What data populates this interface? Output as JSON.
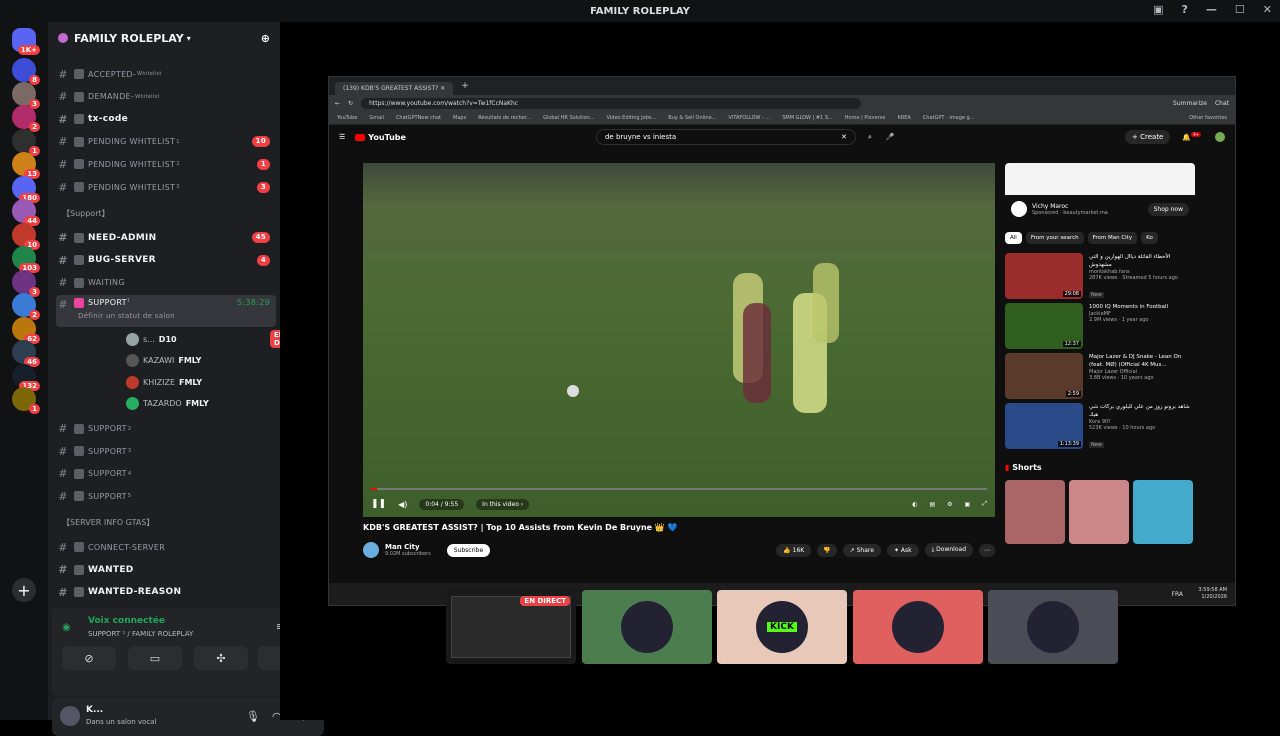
{
  "window": {
    "title": "FAMILY ROLEPLAY"
  },
  "rail": {
    "home_badge": "1K+",
    "servers": [
      {
        "name": "srv-1",
        "color": "#3e4dd8",
        "badge": "8"
      },
      {
        "name": "srv-2",
        "color": "#7a6a63",
        "badge": "3"
      },
      {
        "name": "srv-3",
        "color": "#b22b6b",
        "badge": "2"
      },
      {
        "name": "srv-4",
        "color": "#2f2f2f",
        "badge": "1"
      },
      {
        "name": "srv-5",
        "color": "#d08018",
        "badge": "13"
      },
      {
        "name": "srv-6",
        "color": "#5865f2",
        "badge": "180"
      },
      {
        "name": "srv-7",
        "color": "#9b59b6",
        "badge": "44"
      },
      {
        "name": "srv-8",
        "color": "#c0392b",
        "badge": "10"
      },
      {
        "name": "srv-9",
        "color": "#1e8449",
        "badge": "103"
      },
      {
        "name": "srv-10",
        "color": "#6c3483",
        "badge": "3"
      },
      {
        "name": "srv-11",
        "color": "#3a7bd5",
        "badge": "2"
      },
      {
        "name": "srv-12",
        "color": "#b9770e",
        "badge": "62"
      },
      {
        "name": "srv-13",
        "color": "#2c3e50",
        "badge": "46"
      },
      {
        "name": "srv-14",
        "color": "#17202a",
        "badge": "132"
      },
      {
        "name": "srv-15",
        "color": "#7d6608",
        "badge": "1"
      }
    ]
  },
  "server": {
    "name": "FAMILY ROLEPLAY"
  },
  "channels": [
    {
      "label": "ACCEPTED-",
      "suffix": "Whitelist",
      "bold": false,
      "count": ""
    },
    {
      "label": "DEMANDE-",
      "suffix": "Whitelist",
      "bold": false,
      "count": ""
    },
    {
      "label": "tx-code",
      "suffix": "",
      "bold": true,
      "count": ""
    },
    {
      "label": "PENDING WHITELIST",
      "suffix": "1",
      "bold": false,
      "count": "10"
    },
    {
      "label": "PENDING WHITELIST",
      "suffix": "2",
      "bold": false,
      "count": "1"
    },
    {
      "label": "PENDING WHITELIST",
      "suffix": "3",
      "bold": false,
      "count": "3"
    }
  ],
  "category_support": "【Support】",
  "support_channels": [
    {
      "label": "NEED-ADMIN",
      "bold": true,
      "count": "45"
    },
    {
      "label": "BUG-SERVER",
      "bold": true,
      "count": "4"
    },
    {
      "label": "WAITING",
      "bold": false,
      "count": ""
    }
  ],
  "active_voice": {
    "label": "SUPPORT",
    "sup": "1",
    "timer": "5:38:29",
    "status": "Définir un statut de salon"
  },
  "voice_users": [
    {
      "name": "s...",
      "tag": "D10",
      "live": "EN DIRECT",
      "color": "#95a5a6"
    },
    {
      "name": "KAZAWI",
      "tag": "FMLY",
      "live": "",
      "color": "#555"
    },
    {
      "name": "KHIZIZE",
      "tag": "FMLY",
      "live": "",
      "color": "#c0392b"
    },
    {
      "name": "TAZARDO",
      "tag": "FMLY",
      "live": "",
      "color": "#27ae60"
    }
  ],
  "more_support": [
    {
      "label": "SUPPORT",
      "sup": "2"
    },
    {
      "label": "SUPPORT",
      "sup": "3"
    },
    {
      "label": "SUPPORT",
      "sup": "4"
    },
    {
      "label": "SUPPORT",
      "sup": "5"
    }
  ],
  "category_info": "【SERVER INFO GTAS】",
  "info_channels": [
    {
      "label": "CONNECT-SERVER",
      "bold": false
    },
    {
      "label": "WANTED",
      "bold": true
    },
    {
      "label": "WANTED-REASON",
      "bold": true
    }
  ],
  "voice_panel": {
    "status": "Voix connectée",
    "location": "SUPPORT ¹ / FAMILY ROLEPLAY"
  },
  "user_panel": {
    "name": "K...",
    "status": "Dans un salon vocal"
  },
  "browser": {
    "tab_title": "(139) KDB'S GREATEST ASSIST?",
    "url": "https://www.youtube.com/watch?v=Tw1fCcNaKhc",
    "summarize": "Summarize",
    "chat": "Chat",
    "bookmarks": [
      "YouTube",
      "Gmail",
      "ChatGPTNew chat",
      "Maps",
      "Résultats de recher...",
      "Global HR Solution...",
      "Video Editing Jobs...",
      "Buy & Sell Online...",
      "VITAFOLLOW - ...",
      "SMM GLOW | #1 S...",
      "Home | Pixverse",
      "KREA",
      "ChatGPT - image g...",
      "Other favorites"
    ]
  },
  "youtube": {
    "logo": "YouTube",
    "search": "de bruyne vs iniesta",
    "create": "Create",
    "notif_count": "9+",
    "time": "0:04 / 9:55",
    "in_video": "In this video ›",
    "progress": 0.01,
    "video_title": "KDB'S GREATEST ASSIST? | Top 10 Assists from Kevin De Bruyne 👑 💙",
    "channel": "Man City",
    "subs": "9.02M subscribers",
    "subscribe": "Subscribe",
    "likes": "16K",
    "share": "Share",
    "ask": "Ask",
    "download": "Download",
    "ad": {
      "brand": "Vichy Maroc",
      "sponsored": "Sponsored · beautymarket.ma",
      "cta": "Shop now"
    },
    "chips": [
      "All",
      "From your search",
      "From Man City",
      "Ko"
    ],
    "recs": [
      {
        "title": "الأخطاء القاتلة دياال الهوارين و التي مشهدوش",
        "channel": "montakhab fans",
        "meta": "287K views · Streamed 5 hours ago",
        "duration": "29:08",
        "badge": "New",
        "color": "#9b2c2c"
      },
      {
        "title": "1000 IQ Moments in Football",
        "channel": "JackieMF",
        "meta": "2.9M views · 1 year ago",
        "duration": "12:37",
        "badge": "",
        "color": "#2f5e1f"
      },
      {
        "title": "Major Lazer & DJ Snake - Lean On (feat. MØ) (Official 4K Mus...",
        "channel": "Major Lazer Official",
        "meta": "3.8B views · 10 years ago",
        "duration": "2:59",
        "badge": "",
        "color": "#5a3a2a"
      },
      {
        "title": "شاهد برونو زوز من علي للبلوري بركات شي هيك",
        "channel": "Kora ؟90",
        "meta": "523K views · 10 hours ago",
        "duration": "1:13:39",
        "badge": "New",
        "color": "#2a4a8a"
      }
    ],
    "shorts": "Shorts"
  },
  "taskbar": {
    "lang": "FRA",
    "time": "3:59:58 AM",
    "date": "1/20/2026"
  },
  "tiles": [
    {
      "name": "tile-screen",
      "color": "#1a1a1a",
      "live": "EN DIRECT",
      "label": ""
    },
    {
      "name": "tile-user-2",
      "color": "#4b7d4e",
      "live": "",
      "label": ""
    },
    {
      "name": "tile-user-3",
      "color": "#e8c8b8",
      "live": "",
      "label": "KICK"
    },
    {
      "name": "tile-user-4",
      "color": "#e06060",
      "live": "",
      "label": ""
    },
    {
      "name": "tile-user-5",
      "color": "#4a4d55",
      "live": "",
      "label": ""
    }
  ]
}
